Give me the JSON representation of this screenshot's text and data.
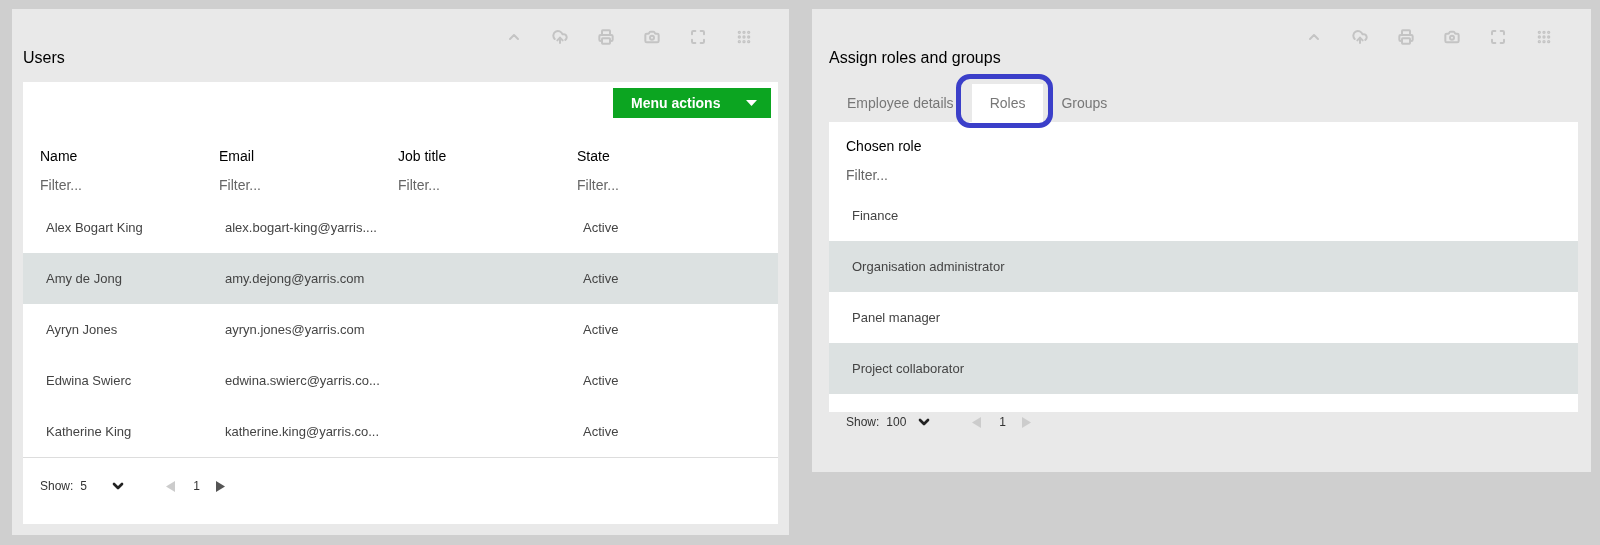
{
  "users_panel": {
    "title": "Users",
    "menu_button": "Menu actions",
    "columns": [
      {
        "label": "Name",
        "filter_placeholder": "Filter..."
      },
      {
        "label": "Email",
        "filter_placeholder": "Filter..."
      },
      {
        "label": "Job title",
        "filter_placeholder": "Filter..."
      },
      {
        "label": "State",
        "filter_placeholder": "Filter..."
      }
    ],
    "rows": [
      {
        "name": "Alex Bogart King",
        "email": "alex.bogart-king@yarris....",
        "state": "Active",
        "selected": false
      },
      {
        "name": "Amy de Jong",
        "email": "amy.dejong@yarris.com",
        "state": "Active",
        "selected": true
      },
      {
        "name": "Ayryn Jones",
        "email": "ayryn.jones@yarris.com",
        "state": "Active",
        "selected": false
      },
      {
        "name": "Edwina Swierc",
        "email": "edwina.swierc@yarris.co...",
        "state": "Active",
        "selected": false
      },
      {
        "name": "Katherine King",
        "email": "katherine.king@yarris.co...",
        "state": "Active",
        "selected": false
      }
    ],
    "pager": {
      "show_label": "Show:",
      "page_size": "5",
      "page": "1",
      "prev_disabled": true,
      "next_disabled": false
    }
  },
  "roles_panel": {
    "title": "Assign roles and groups",
    "tabs": [
      {
        "label": "Employee details",
        "selected": false,
        "highlighted": false
      },
      {
        "label": "Roles",
        "selected": true,
        "highlighted": true
      },
      {
        "label": "Groups",
        "selected": false,
        "highlighted": false
      }
    ],
    "column": {
      "label": "Chosen role",
      "filter_placeholder": "Filter..."
    },
    "rows": [
      {
        "name": "Finance",
        "selected": false
      },
      {
        "name": "Organisation administrator",
        "selected": true
      },
      {
        "name": "Panel manager",
        "selected": false
      },
      {
        "name": "Project collaborator",
        "selected": true
      }
    ],
    "pager": {
      "show_label": "Show:",
      "page_size": "100",
      "page": "1",
      "prev_disabled": true,
      "next_disabled": true
    }
  }
}
